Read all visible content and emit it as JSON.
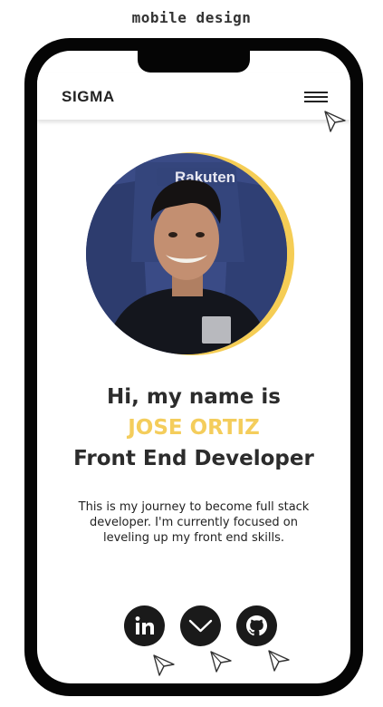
{
  "caption": "mobile design",
  "navbar": {
    "brand": "SIGMA",
    "menu_icon": "hamburger-menu-icon"
  },
  "profile": {
    "photo_alt": "Profile photo of Jose Ortiz",
    "photo_text": "Rakuten",
    "ring_color": "#f5cd55"
  },
  "hero": {
    "greeting": "Hi, my name is",
    "name": "JOSE ORTIZ",
    "role": "Front End Developer",
    "bio": "This is my journey to become full stack developer. I'm currently focused on leveling up my front end skills.",
    "accent_color": "#f4cd5c"
  },
  "socials": [
    {
      "icon": "linkedin-icon"
    },
    {
      "icon": "chevron-down-icon"
    },
    {
      "icon": "github-icon"
    }
  ],
  "annotation_icon": "cursor-arrow-icon"
}
